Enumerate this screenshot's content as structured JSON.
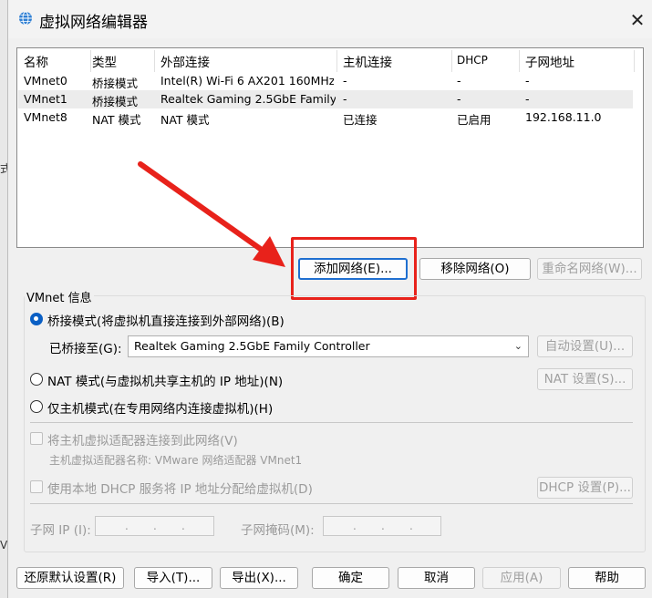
{
  "window": {
    "title": "虚拟网络编辑器",
    "close": "✕"
  },
  "background": {
    "glyph1": "式",
    "glyph2": "V"
  },
  "table": {
    "headers": [
      "名称",
      "类型",
      "外部连接",
      "主机连接",
      "DHCP",
      "子网地址"
    ],
    "rows": [
      [
        "VMnet0",
        "桥接模式",
        "Intel(R) Wi-Fi 6 AX201 160MHz",
        "-",
        "-",
        "-"
      ],
      [
        "VMnet1",
        "桥接模式",
        "Realtek Gaming 2.5GbE Family...",
        "-",
        "-",
        "-"
      ],
      [
        "VMnet8",
        "NAT 模式",
        "NAT 模式",
        "已连接",
        "已启用",
        "192.168.11.0"
      ]
    ]
  },
  "actions": {
    "add_network": "添加网络(E)...",
    "remove_network": "移除网络(O)",
    "rename_network": "重命名网络(W)..."
  },
  "vmnet_info": {
    "title": "VMnet 信息",
    "bridged_label": "桥接模式(将虚拟机直接连接到外部网络)(B)",
    "bridged_to_label": "已桥接至(G):",
    "bridged_to_value": "Realtek Gaming 2.5GbE Family Controller",
    "auto_settings": "自动设置(U)...",
    "nat_label": "NAT 模式(与虚拟机共享主机的 IP 地址)(N)",
    "nat_settings": "NAT 设置(S)...",
    "host_only_label": "仅主机模式(在专用网络内连接虚拟机)(H)",
    "connect_adapter_label": "将主机虚拟适配器连接到此网络(V)",
    "adapter_name_label": "主机虚拟适配器名称: VMware 网络适配器 VMnet1",
    "use_dhcp_label": "使用本地 DHCP 服务将 IP 地址分配给虚拟机(D)",
    "dhcp_settings": "DHCP 设置(P)...",
    "subnet_ip_label": "子网 IP (I):",
    "subnet_mask_label": "子网掩码(M):",
    "ip_dot": "."
  },
  "footer": {
    "restore_defaults": "还原默认设置(R)",
    "import": "导入(T)...",
    "export": "导出(X)...",
    "ok": "确定",
    "cancel": "取消",
    "apply": "应用(A)",
    "help": "帮助"
  },
  "selected": {
    "bridged": true,
    "row": 1
  }
}
